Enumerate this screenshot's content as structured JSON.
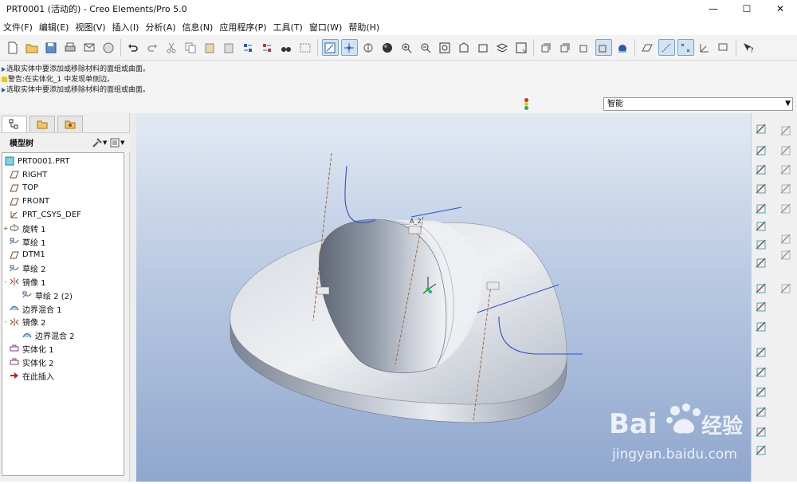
{
  "window": {
    "title": "PRT0001 (活动的) - Creo Elements/Pro 5.0",
    "controls": [
      "—",
      "☐",
      "✕"
    ]
  },
  "menu": [
    "文件(F)",
    "编辑(E)",
    "视图(V)",
    "插入(I)",
    "分析(A)",
    "信息(N)",
    "应用程序(P)",
    "工具(T)",
    "窗口(W)",
    "帮助(H)"
  ],
  "messages": [
    "选取实体中要添加或移除材料的面组或曲面。",
    "警告:在实体化_1 中发现单侧边。",
    "选取实体中要添加或移除材料的面组或曲面。"
  ],
  "filter": {
    "value": "智能"
  },
  "tree": {
    "title": "模型树",
    "root": "PRT0001.PRT",
    "items": [
      {
        "label": "RIGHT",
        "icon": "datum-plane-icon",
        "indent": 0,
        "expand": ""
      },
      {
        "label": "TOP",
        "icon": "datum-plane-icon",
        "indent": 0,
        "expand": ""
      },
      {
        "label": "FRONT",
        "icon": "datum-plane-icon",
        "indent": 0,
        "expand": ""
      },
      {
        "label": "PRT_CSYS_DEF",
        "icon": "csys-icon",
        "indent": 0,
        "expand": ""
      },
      {
        "label": "旋转 1",
        "icon": "revolve-icon",
        "indent": 0,
        "expand": "+"
      },
      {
        "label": "草绘 1",
        "icon": "sketch-icon",
        "indent": 0,
        "expand": ""
      },
      {
        "label": "DTM1",
        "icon": "datum-plane-icon",
        "indent": 0,
        "expand": ""
      },
      {
        "label": "草绘 2",
        "icon": "sketch-icon",
        "indent": 0,
        "expand": ""
      },
      {
        "label": "镜像 1",
        "icon": "mirror-icon",
        "indent": 0,
        "expand": "-"
      },
      {
        "label": "草绘 2 (2)",
        "icon": "sketch-icon",
        "indent": 1,
        "expand": ""
      },
      {
        "label": "边界混合 1",
        "icon": "boundary-blend-icon",
        "indent": 0,
        "expand": ""
      },
      {
        "label": "镜像 2",
        "icon": "mirror-icon",
        "indent": 0,
        "expand": "-"
      },
      {
        "label": "边界混合 2",
        "icon": "boundary-blend-icon",
        "indent": 1,
        "expand": ""
      },
      {
        "label": "实体化 1",
        "icon": "solidify-icon",
        "indent": 0,
        "expand": ""
      },
      {
        "label": "实体化 2",
        "icon": "solidify-icon",
        "indent": 0,
        "expand": ""
      },
      {
        "label": "在此插入",
        "icon": "insert-here-icon",
        "indent": 0,
        "expand": ""
      }
    ]
  },
  "model_labels": {
    "a2": "A_2"
  },
  "watermark": {
    "text1": "Bai",
    "text2": "经验",
    "url": "jingyan.baidu.com"
  },
  "colors": {
    "accent": "#2a5db0",
    "insert": "#c81e1e"
  }
}
